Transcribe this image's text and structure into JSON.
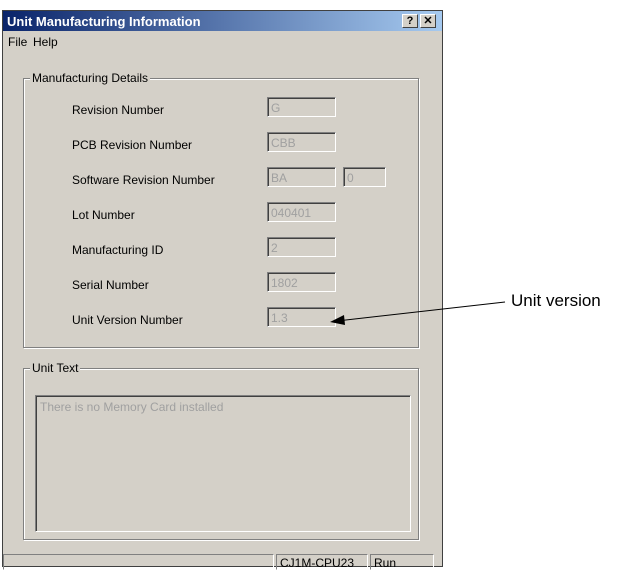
{
  "window": {
    "title": "Unit Manufacturing Information",
    "help_button": "?",
    "close_button": "✕"
  },
  "menu": {
    "file": "File",
    "help": "Help"
  },
  "manufacturing": {
    "group_title": "Manufacturing Details",
    "revision_label": "Revision Number",
    "revision_value": "G",
    "pcb_label": "PCB Revision Number",
    "pcb_value": "CBB",
    "software_label": "Software Revision Number",
    "software_value": "BA",
    "software_value2": "0",
    "lot_label": "Lot Number",
    "lot_value": "040401",
    "mfg_id_label": "Manufacturing ID",
    "mfg_id_value": "2",
    "serial_label": "Serial Number",
    "serial_value": "1802",
    "unit_version_label": "Unit Version Number",
    "unit_version_value": "1.3"
  },
  "unit_text": {
    "group_title": "Unit Text",
    "content": "There is no Memory Card installed"
  },
  "status": {
    "model": "CJ1M-CPU23",
    "mode": "Run"
  },
  "callout": {
    "label": "Unit version"
  }
}
